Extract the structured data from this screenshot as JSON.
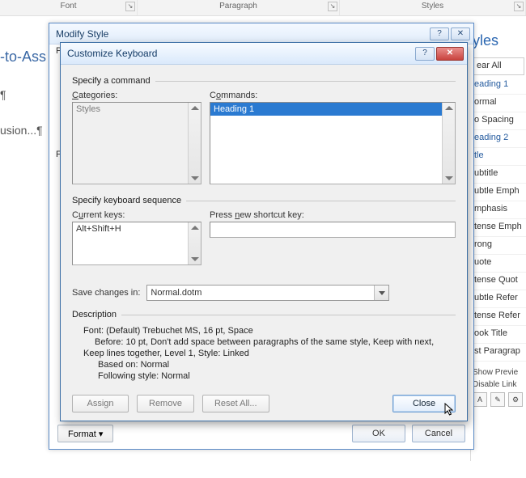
{
  "ribbon": {
    "groups": [
      "Font",
      "Paragraph",
      "Styles"
    ]
  },
  "doc_fragments": [
    "-to-Ass",
    "¶",
    "usion...¶"
  ],
  "styles_pane": {
    "header": "yles",
    "items": [
      "ear All",
      "eading 1",
      "ormal",
      "o Spacing",
      "eading 2",
      "tle",
      "ubtitle",
      "ubtle Emph",
      "mphasis",
      "tense Emph",
      "rong",
      "uote",
      "tense Quot",
      "ubtle Refer",
      "tense Refer",
      "ook Title",
      "st Paragrap"
    ],
    "footer": [
      "Show Previe",
      "Disable Link"
    ]
  },
  "modify_dialog": {
    "title": "Modify Style",
    "left_labels": [
      "Pr",
      "Fo"
    ],
    "format_btn": "Format ▾",
    "ok": "OK",
    "cancel": "Cancel"
  },
  "ck": {
    "title": "Customize Keyboard",
    "group1": "Specify a command",
    "categories_label": "Categories:",
    "commands_label": "Commands:",
    "categories": [
      "Styles"
    ],
    "commands": [
      "Heading 1"
    ],
    "group2": "Specify keyboard sequence",
    "current_keys_label": "Current keys:",
    "press_new_label": "Press new shortcut key:",
    "current_keys": [
      "Alt+Shift+H"
    ],
    "press_new_value": "",
    "save_label": "Save changes in:",
    "save_value": "Normal.dotm",
    "desc_header": "Description",
    "desc_lines": [
      "Font: (Default) Trebuchet MS, 16 pt, Space",
      "Before:  10 pt, Don't add space between paragraphs of the same style, Keep with next,",
      "Keep lines together, Level 1, Style: Linked",
      "Based on: Normal",
      "Following style: Normal"
    ],
    "buttons": {
      "assign": "Assign",
      "remove": "Remove",
      "reset": "Reset All...",
      "close": "Close"
    }
  }
}
